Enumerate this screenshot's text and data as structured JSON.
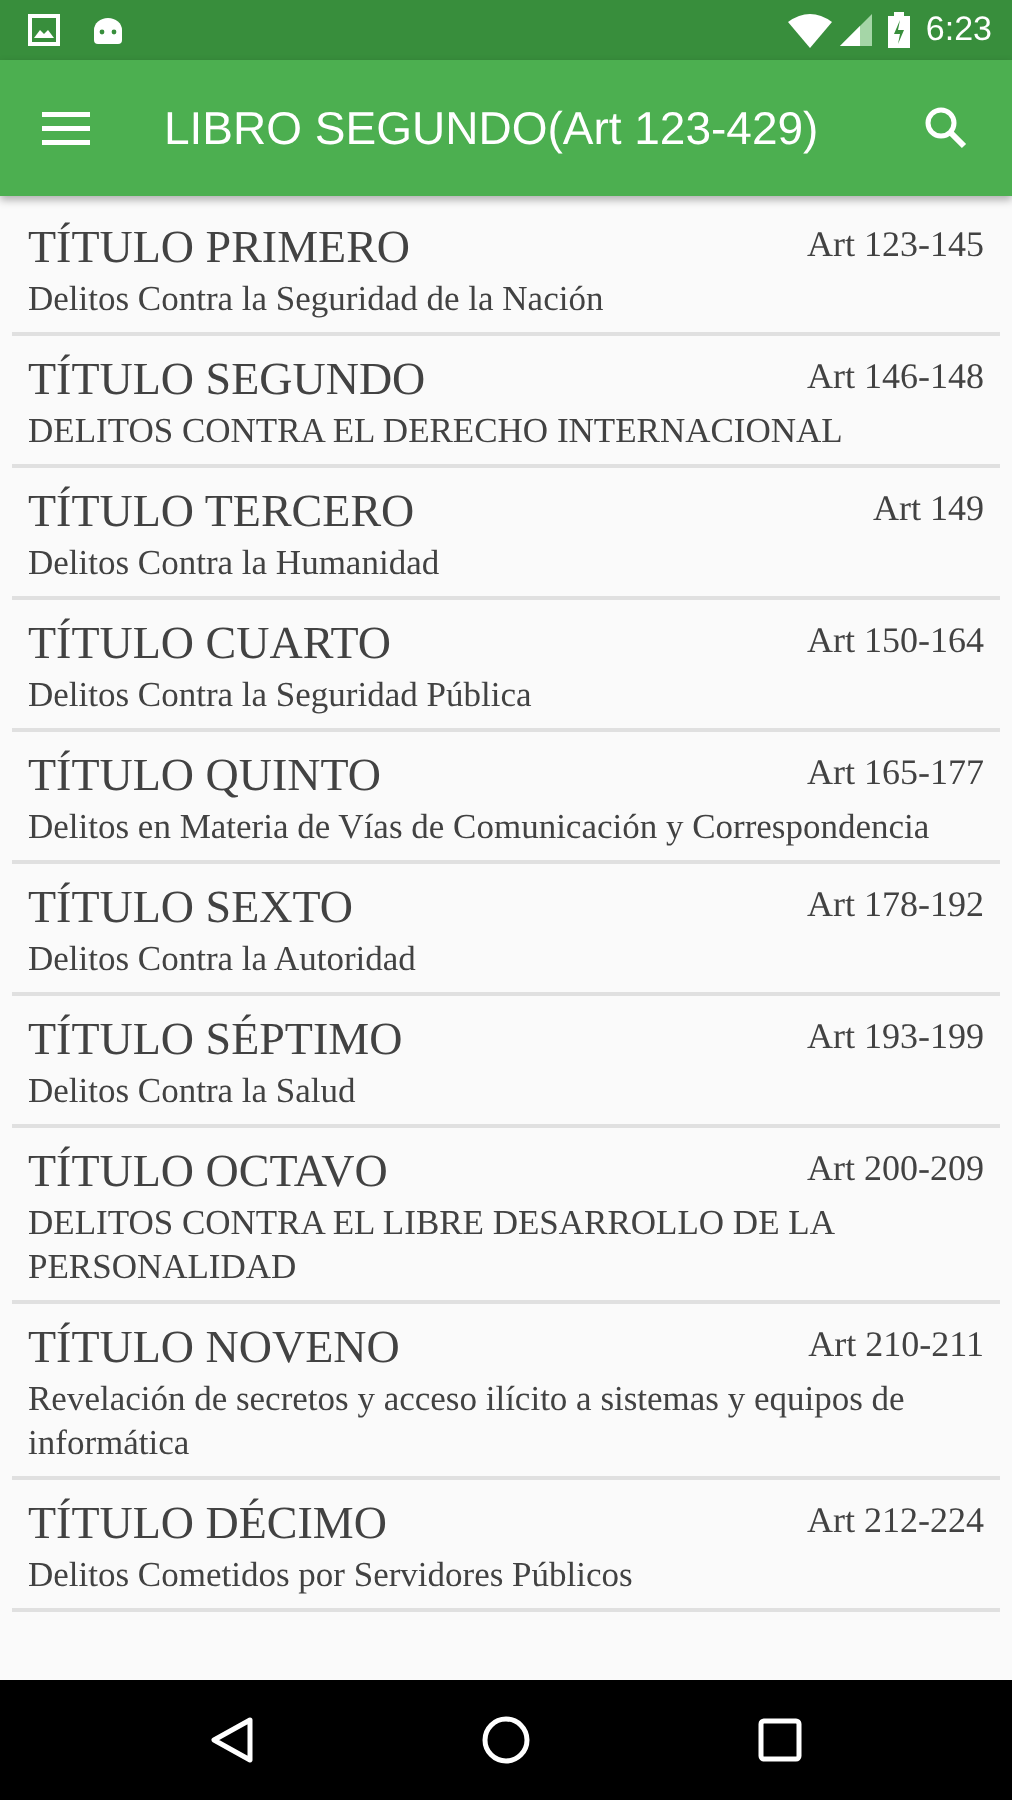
{
  "status_bar": {
    "time": "6:23"
  },
  "toolbar": {
    "title": "LIBRO SEGUNDO(Art 123-429)"
  },
  "items": [
    {
      "title": "TÍTULO PRIMERO",
      "articles": "Art 123-145",
      "subtitle": "Delitos Contra la Seguridad de la Nación"
    },
    {
      "title": "TÍTULO SEGUNDO",
      "articles": "Art 146-148",
      "subtitle": "DELITOS CONTRA EL DERECHO INTERNACIONAL"
    },
    {
      "title": "TÍTULO TERCERO",
      "articles": "Art 149",
      "subtitle": "Delitos Contra la Humanidad"
    },
    {
      "title": "TÍTULO CUARTO",
      "articles": "Art 150-164",
      "subtitle": "Delitos Contra la Seguridad Pública"
    },
    {
      "title": "TÍTULO QUINTO",
      "articles": "Art 165-177",
      "subtitle": "Delitos en Materia de Vías de Comunicación y Correspondencia"
    },
    {
      "title": "TÍTULO SEXTO",
      "articles": "Art 178-192",
      "subtitle": "Delitos Contra la Autoridad"
    },
    {
      "title": "TÍTULO SÉPTIMO",
      "articles": "Art 193-199",
      "subtitle": "Delitos Contra la Salud"
    },
    {
      "title": "TÍTULO OCTAVO",
      "articles": "Art 200-209",
      "subtitle": "DELITOS CONTRA EL LIBRE DESARROLLO DE LA PERSONALIDAD"
    },
    {
      "title": "TÍTULO NOVENO",
      "articles": "Art 210-211",
      "subtitle": "Revelación de secretos y acceso ilícito a sistemas y equipos de informática"
    },
    {
      "title": "TÍTULO DÉCIMO",
      "articles": "Art 212-224",
      "subtitle": "Delitos Cometidos por Servidores Públicos"
    }
  ]
}
